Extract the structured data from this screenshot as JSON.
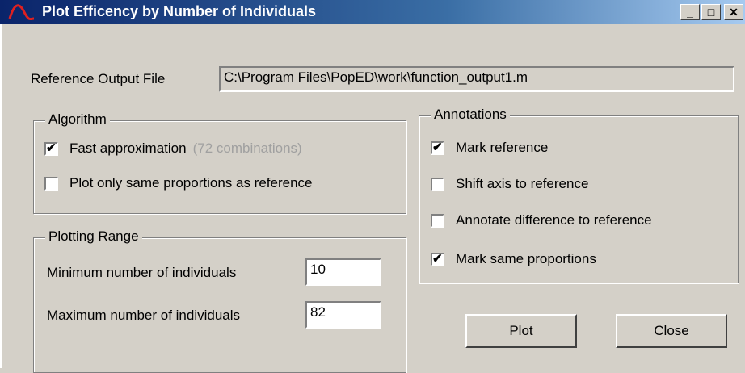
{
  "window": {
    "title": "Plot Efficency by Number of Individuals",
    "controls": {
      "minimize": "_",
      "maximize": "□",
      "close": "✕"
    }
  },
  "reference": {
    "label": "Reference Output File",
    "value": "C:\\Program Files\\PopED\\work\\function_output1.m"
  },
  "algorithm": {
    "legend": "Algorithm",
    "fast_approx": {
      "label": "Fast approximation",
      "note": "(72 combinations)",
      "checked": true
    },
    "same_proportions": {
      "label": "Plot only same proportions as reference",
      "checked": false
    }
  },
  "plotting_range": {
    "legend": "Plotting Range",
    "min_label": "Minimum number of individuals",
    "min_value": "10",
    "max_label": "Maximum number of individuals",
    "max_value": "82"
  },
  "annotations": {
    "legend": "Annotations",
    "items": [
      {
        "label": "Mark reference",
        "checked": true
      },
      {
        "label": "Shift axis to reference",
        "checked": false
      },
      {
        "label": "Annotate difference to reference",
        "checked": false
      },
      {
        "label": "Mark same proportions",
        "checked": true
      }
    ]
  },
  "buttons": {
    "plot": "Plot",
    "close": "Close"
  },
  "check_glyph": "✔"
}
